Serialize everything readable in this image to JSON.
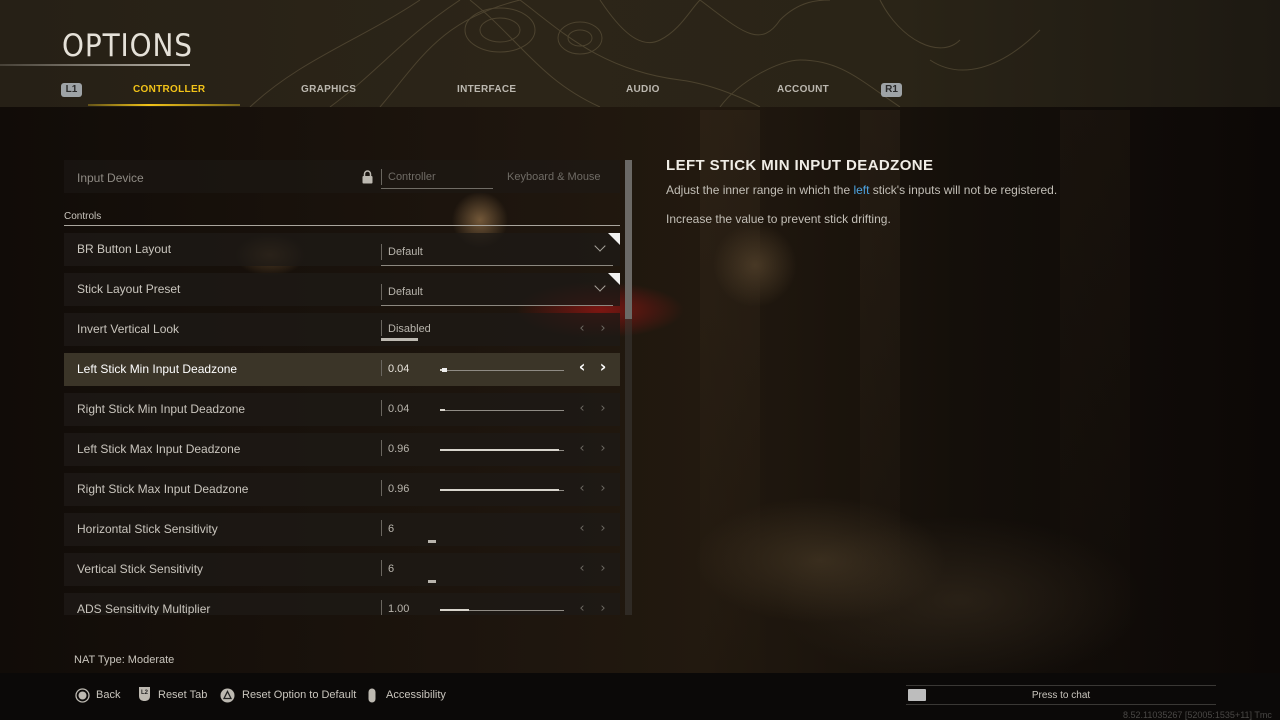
{
  "header": {
    "title": "OPTIONS",
    "bumper_left": "L1",
    "bumper_right": "R1",
    "tabs": [
      {
        "label": "CONTROLLER",
        "active": true
      },
      {
        "label": "GRAPHICS",
        "active": false
      },
      {
        "label": "INTERFACE",
        "active": false
      },
      {
        "label": "AUDIO",
        "active": false
      },
      {
        "label": "ACCOUNT",
        "active": false
      }
    ],
    "active_color": "#f2c318"
  },
  "input_device": {
    "label": "Input Device",
    "locked": true,
    "options": [
      "Controller",
      "Keyboard & Mouse"
    ],
    "selected": "Controller"
  },
  "section": {
    "label": "Controls"
  },
  "settings": [
    {
      "label": "BR Button Layout",
      "type": "dropdown",
      "value": "Default",
      "flagged": true
    },
    {
      "label": "Stick Layout Preset",
      "type": "dropdown",
      "value": "Default",
      "flagged": true
    },
    {
      "label": "Invert Vertical Look",
      "type": "toggle",
      "value": "Disabled"
    },
    {
      "label": "Left Stick Min Input Deadzone",
      "type": "slider",
      "value": "0.04",
      "fraction": 0.04,
      "selected": true
    },
    {
      "label": "Right Stick Min Input Deadzone",
      "type": "slider",
      "value": "0.04",
      "fraction": 0.04
    },
    {
      "label": "Left Stick Max Input Deadzone",
      "type": "slider",
      "value": "0.96",
      "fraction": 0.96
    },
    {
      "label": "Right Stick Max Input Deadzone",
      "type": "slider",
      "value": "0.96",
      "fraction": 0.96
    },
    {
      "label": "Horizontal Stick Sensitivity",
      "type": "stepper",
      "value": "6"
    },
    {
      "label": "Vertical Stick Sensitivity",
      "type": "stepper",
      "value": "6"
    },
    {
      "label": "ADS Sensitivity Multiplier",
      "type": "slider",
      "value": "1.00",
      "fraction": 0.23
    }
  ],
  "scroll": {
    "visible_fraction": 0.35,
    "position": 0
  },
  "description": {
    "title": "LEFT STICK MIN INPUT DEADZONE",
    "line1_before": "Adjust the inner range in which the ",
    "line1_highlight": "left",
    "line1_after": " stick's inputs will not be registered.",
    "line2": "Increase the value to prevent stick drifting.",
    "highlight_color": "#4da3e0"
  },
  "footer": {
    "nat": "NAT Type: Moderate",
    "hints": [
      {
        "icon": "circle-button-icon",
        "label": "Back"
      },
      {
        "icon": "l2-trigger-icon",
        "label": "Reset Tab"
      },
      {
        "icon": "triangle-button-icon",
        "label": "Reset Option to Default"
      },
      {
        "icon": "stick-button-icon",
        "label": "Accessibility"
      }
    ],
    "chat_placeholder": "Press to chat",
    "version": "8.52.11035267 [52005:1535+11] Tmc"
  }
}
